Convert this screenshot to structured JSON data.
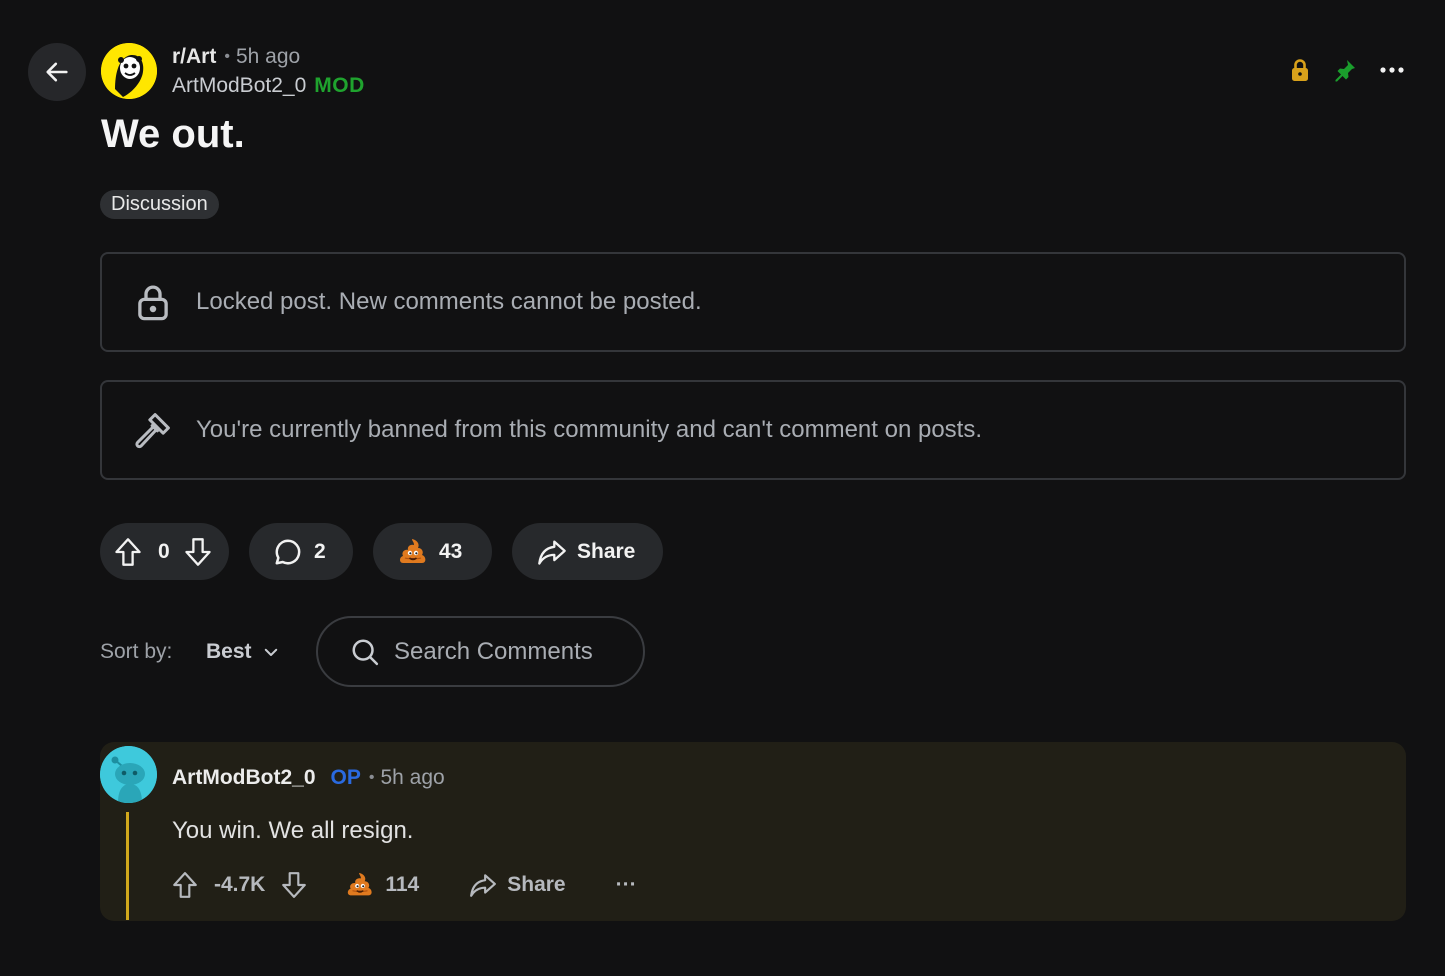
{
  "header": {
    "subreddit": "r/Art",
    "separator": "•",
    "time_ago": "5h ago",
    "author": "ArtModBot2_0",
    "author_badge": "MOD",
    "icons": [
      "lock-icon",
      "pin-icon",
      "more-options-icon"
    ]
  },
  "post": {
    "title": "We out.",
    "flair": "Discussion"
  },
  "notices": {
    "locked": "Locked post. New comments cannot be posted.",
    "banned": "You're currently banned from this community and can't comment on posts."
  },
  "actions": {
    "vote_count": "0",
    "comment_count": "2",
    "award_count": "43",
    "share_label": "Share"
  },
  "comments_toolbar": {
    "sort_label": "Sort by:",
    "sort_value": "Best",
    "search_placeholder": "Search Comments"
  },
  "comment": {
    "author": "ArtModBot2_0",
    "badge": "OP",
    "separator": "•",
    "time_ago": "5h ago",
    "body": "You win. We all resign.",
    "score": "-4.7K",
    "award_count": "114",
    "share_label": "Share",
    "more_label": "···"
  },
  "colors": {
    "background": "#111112",
    "mod_green": "#1fa32e",
    "op_blue": "#2a6ae0",
    "lock_gold": "#d9a21b",
    "pin_green": "#1a9e2c",
    "thread_gold": "#d1a81c",
    "comment_bg": "#211f16"
  }
}
